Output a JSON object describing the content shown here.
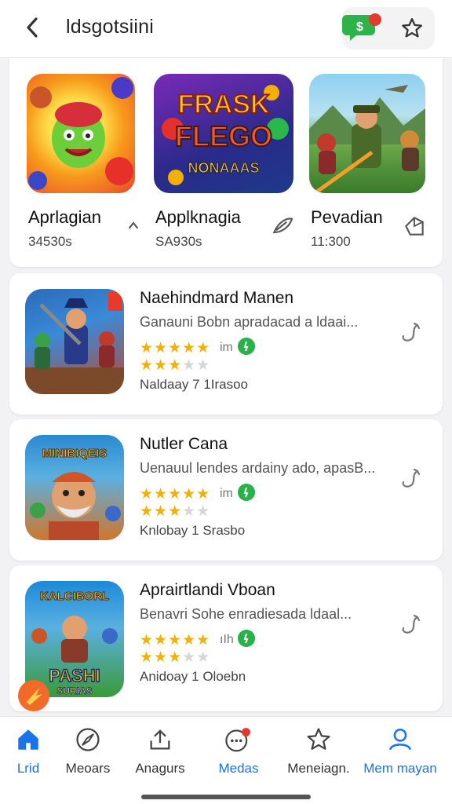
{
  "header": {
    "title": "ldsgotsiini",
    "chat_badge_text": "$",
    "back_icon": "chevron-left-icon",
    "chat_icon": "chat-bubble-icon",
    "star_icon": "star-icon"
  },
  "featured": [
    {
      "name": "Aprlagian",
      "stat": "34530s",
      "icon": "chevron-up-icon",
      "art_text": "",
      "colors": [
        "#f7b21b",
        "#e84a2a"
      ]
    },
    {
      "name": "Applknagia",
      "stat": "SA930s",
      "icon": "feather-icon",
      "art_text": "FRASK FLEGO NONAAAS",
      "colors": [
        "#6a2aa8",
        "#1d3a8a"
      ]
    },
    {
      "name": "Pevadian",
      "stat": "11:300",
      "icon": "tag-icon",
      "art_text": "",
      "colors": [
        "#7fc6e8",
        "#4a8a3a"
      ]
    }
  ],
  "apps": [
    {
      "title": "Naehindmard Manen",
      "desc": "Ganauni Bobn apradacad a ldaai...",
      "rating_meta": "im",
      "sub": "Naldaay 7 1Irasoo",
      "art_colors": [
        "#2b6bb8",
        "#c0452a"
      ],
      "art_text": ""
    },
    {
      "title": "Nutler Cana",
      "desc": "Uenauul lendes ardainy ado, apasB...",
      "rating_meta": "im",
      "sub": "Knlobay 1 Srasbo",
      "art_colors": [
        "#2a8ad0",
        "#d0762a"
      ],
      "art_text": "MINIBIQEIS"
    },
    {
      "title": "Aprairtlandi Vboan",
      "desc": "Benavri Sohe enradiesada ldaal...",
      "rating_meta": "ıIh",
      "sub": "Anidoay 1 Oloebn",
      "art_colors": [
        "#1c8ad8",
        "#3a9a3a"
      ],
      "art_text": "PASHI SURIAS"
    }
  ],
  "nav": {
    "items": [
      {
        "label": "Lrid",
        "icon": "home-icon",
        "active": true
      },
      {
        "label": "Meoars",
        "icon": "compass-icon",
        "active": false
      },
      {
        "label": "Anagurs",
        "icon": "upload-icon",
        "active": false
      },
      {
        "label": "Medas",
        "icon": "chat-icon",
        "active": true
      },
      {
        "label": "Meneiagn.",
        "icon": "star-icon",
        "active": false
      },
      {
        "label": "Mem mayan",
        "icon": "person-icon",
        "active": true
      }
    ]
  },
  "colors": {
    "accent": "#1a73e8",
    "star": "#f2b100",
    "verified": "#29b24a"
  }
}
